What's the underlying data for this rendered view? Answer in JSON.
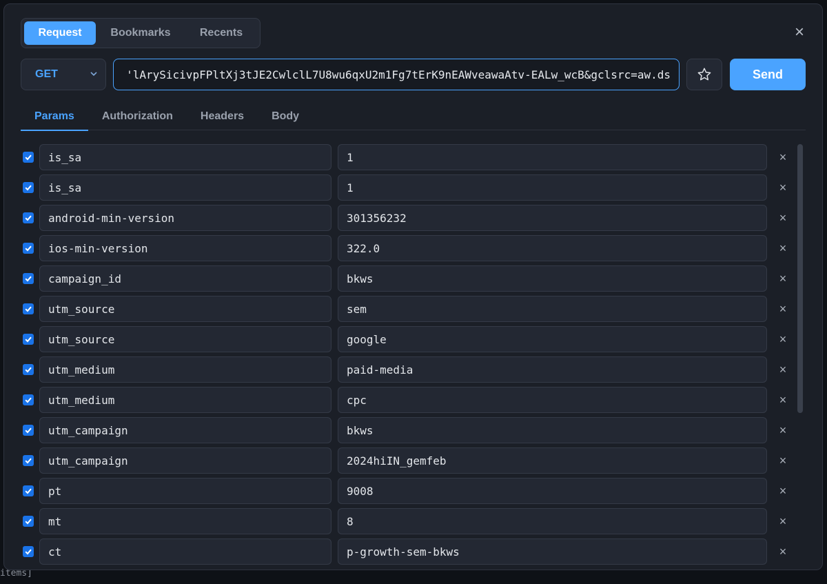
{
  "backdrop": {
    "text": "items]"
  },
  "top_tabs": [
    {
      "label": "Request",
      "active": true
    },
    {
      "label": "Bookmarks",
      "active": false
    },
    {
      "label": "Recents",
      "active": false
    }
  ],
  "request": {
    "method": "GET",
    "url": "'lArySicivpFPltXj3tJE2CwlclL7U8wu6qxU2m1Fg7tErK9nEAWveawaAtv-EALw_wcB&gclsrc=aw.ds",
    "send_label": "Send"
  },
  "sub_tabs": [
    {
      "label": "Params",
      "active": true
    },
    {
      "label": "Authorization",
      "active": false
    },
    {
      "label": "Headers",
      "active": false
    },
    {
      "label": "Body",
      "active": false
    }
  ],
  "params": [
    {
      "key": "is_sa",
      "value": "1",
      "checked": true
    },
    {
      "key": "is_sa",
      "value": "1",
      "checked": true
    },
    {
      "key": "android-min-version",
      "value": "301356232",
      "checked": true
    },
    {
      "key": "ios-min-version",
      "value": "322.0",
      "checked": true
    },
    {
      "key": "campaign_id",
      "value": "bkws",
      "checked": true
    },
    {
      "key": "utm_source",
      "value": "sem",
      "checked": true
    },
    {
      "key": "utm_source",
      "value": "google",
      "checked": true
    },
    {
      "key": "utm_medium",
      "value": "paid-media",
      "checked": true
    },
    {
      "key": "utm_medium",
      "value": "cpc",
      "checked": true
    },
    {
      "key": "utm_campaign",
      "value": "bkws",
      "checked": true
    },
    {
      "key": "utm_campaign",
      "value": "2024hiIN_gemfeb",
      "checked": true
    },
    {
      "key": "pt",
      "value": "9008",
      "checked": true
    },
    {
      "key": "mt",
      "value": "8",
      "checked": true
    },
    {
      "key": "ct",
      "value": "p-growth-sem-bkws",
      "checked": true
    }
  ],
  "colors": {
    "accent": "#4aa3ff",
    "checkbox": "#1a73e8",
    "panel": "#1b1f27"
  }
}
